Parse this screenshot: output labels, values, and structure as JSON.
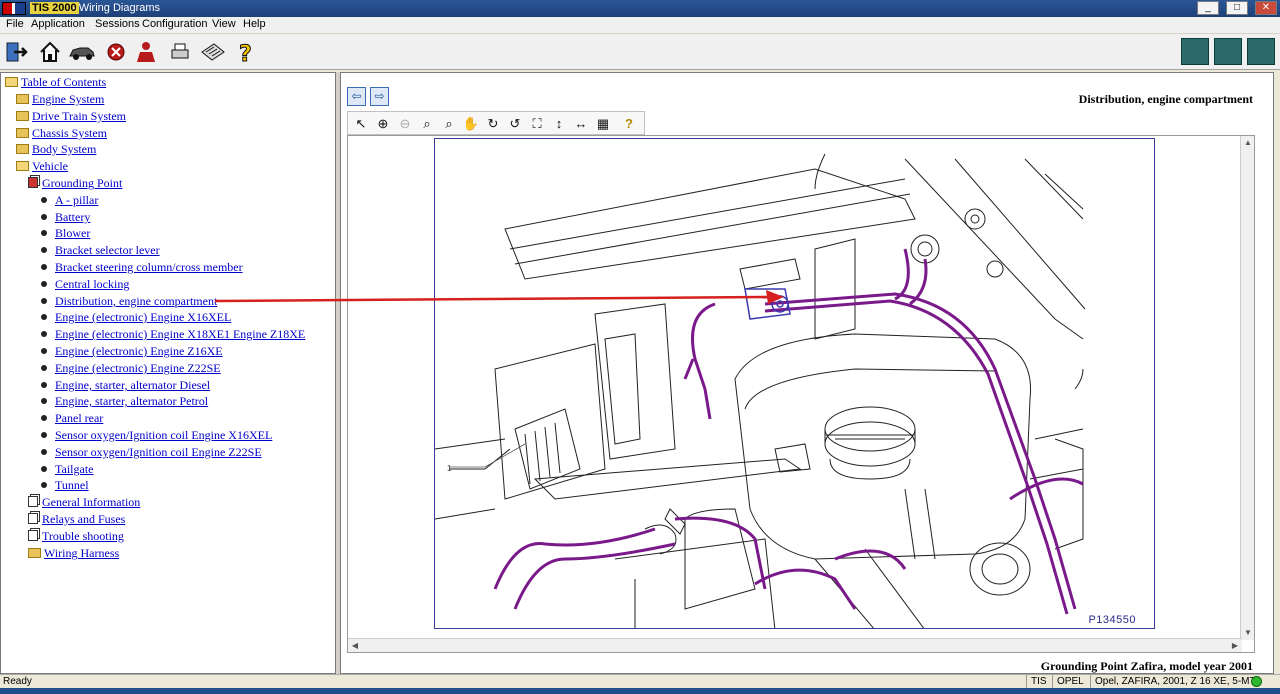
{
  "window": {
    "app_name": "TIS 2000",
    "title": "Wiring Diagrams",
    "title_separator": " - ",
    "minimize": "_",
    "maximize": "□",
    "close": "✕"
  },
  "menu": [
    "File",
    "Application",
    "Sessions",
    "Configuration",
    "View",
    "Help"
  ],
  "toolbar": {
    "icons": [
      "exit-icon",
      "home-icon",
      "vehicle-icon",
      "stop-icon",
      "user-icon",
      "print-icon",
      "notepad-icon",
      "help-icon"
    ],
    "right_icons": [
      "module-icon",
      "module2-icon",
      "module3-icon"
    ]
  },
  "tree": {
    "root": "Table of Contents",
    "systems": [
      "Engine System",
      "Drive Train System",
      "Chassis System",
      "Body System"
    ],
    "vehicle": "Vehicle",
    "grounding": "Grounding Point",
    "grounding_items": [
      "A - pillar",
      "Battery",
      "Blower",
      "Bracket selector lever",
      "Bracket steering column/cross member",
      "Central locking",
      "Distribution, engine compartment",
      "Engine (electronic) Engine X16XEL",
      "Engine (electronic) Engine X18XE1 Engine Z18XE",
      "Engine (electronic) Engine Z16XE",
      "Engine (electronic) Engine Z22SE",
      "Engine, starter, alternator Diesel",
      "Engine, starter, alternator Petrol",
      "Panel rear",
      "Sensor oxygen/Ignition coil Engine X16XEL",
      "Sensor oxygen/Ignition coil Engine Z22SE",
      "Tailgate",
      "Tunnel"
    ],
    "vehicle_more": [
      "General Information",
      "Relays and Fuses",
      "Trouble shooting"
    ],
    "wiring": "Wiring Harness"
  },
  "viewer": {
    "doc_title": "Distribution, engine compartment",
    "back": "⇦",
    "forward": "⇨",
    "tools": [
      "↖",
      "⊕",
      "⊖",
      "⌕",
      "⌕",
      "✋",
      "↻",
      "↺",
      "⛶",
      "↕",
      "↔",
      "▦",
      "?"
    ],
    "drawing_code": "P134550",
    "callout": "1",
    "subtitle": "Grounding Point Zafira, model year 2001"
  },
  "status": {
    "text": "Ready",
    "cells": [
      "TIS",
      "OPEL",
      "Opel, ZAFIRA, 2001, Z 16 XE, 5-MT"
    ]
  },
  "colors": {
    "wire": "#7a1a8a",
    "link": "#0000cc",
    "arrow": "#d61f1f"
  }
}
